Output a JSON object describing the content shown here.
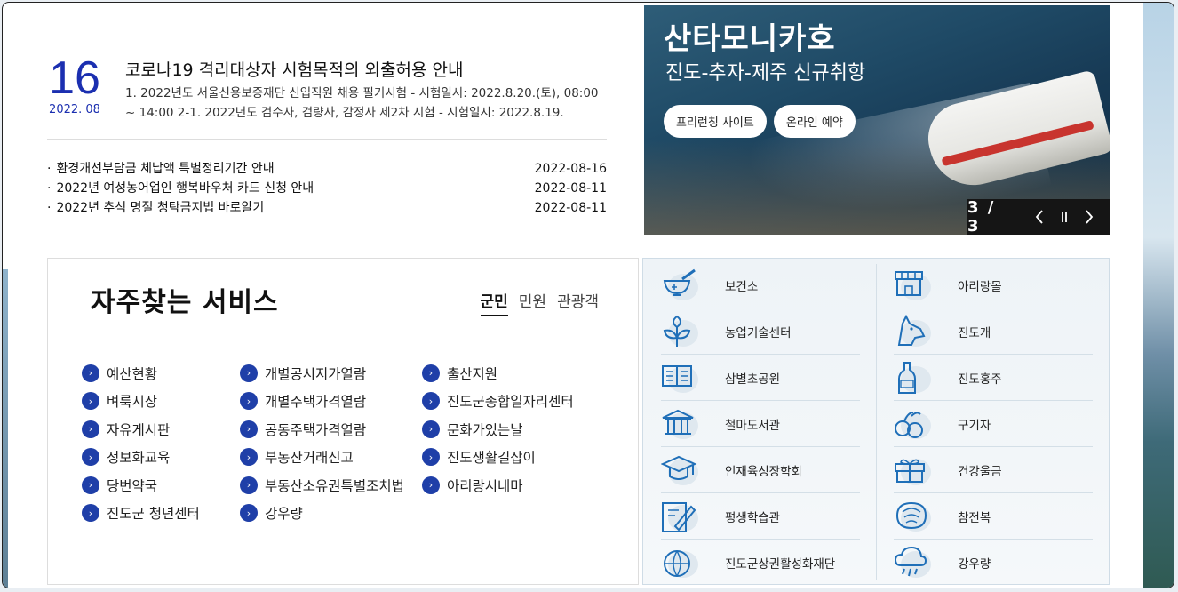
{
  "news": {
    "featured": {
      "day": "16",
      "year_month": "2022. 08",
      "title": "코로나19 격리대상자 시험목적의 외출허용 안내",
      "body": "1. 2022년도 서울신용보증재단 신입직원 채용 필기시험 - 시험일시: 2022.8.20.(토), 08:00 ~ 14:00 2-1. 2022년도 검수사, 검량사, 감정사 제2차 시험 - 시험일시: 2022.8.19."
    },
    "items": [
      {
        "title": "환경개선부담금 체납액 특별정리기간 안내",
        "date": "2022-08-16"
      },
      {
        "title": "2022년 여성농어업인 행복바우처 카드 신청 안내",
        "date": "2022-08-11"
      },
      {
        "title": "2022년 추석 명절 청탁금지법 바로알기",
        "date": "2022-08-11"
      }
    ]
  },
  "banner": {
    "title": "산타모니카호",
    "subtitle": "진도-추자-제주 신규취항",
    "buttons": [
      "프리런칭 사이트",
      "온라인 예약"
    ],
    "pager": "3 / 3",
    "icons": [
      "chevron-left-icon",
      "pause-icon",
      "chevron-right-icon"
    ]
  },
  "services": {
    "title": "자주찾는 서비스",
    "tabs": [
      "군민",
      "민원",
      "관광객"
    ],
    "active_tab": "군민",
    "items": [
      "예산현황",
      "개별공시지가열람",
      "출산지원",
      "벼룩시장",
      "개별주택가격열람",
      "진도군종합일자리센터",
      "자유게시판",
      "공동주택가격열람",
      "문화가있는날",
      "정보화교육",
      "부동산거래신고",
      "진도생활길잡이",
      "당번약국",
      "부동산소유권특별조치법",
      "아리랑시네마",
      "진도군 청년센터",
      "강우량"
    ]
  },
  "orgs": {
    "left": [
      {
        "label": "보건소",
        "icon": "mortar-pestle-icon"
      },
      {
        "label": "농업기술센터",
        "icon": "sprout-icon"
      },
      {
        "label": "삼별초공원",
        "icon": "book-icon"
      },
      {
        "label": "철마도서관",
        "icon": "library-building-icon"
      },
      {
        "label": "인재육성장학회",
        "icon": "graduation-cap-icon"
      },
      {
        "label": "평생학습관",
        "icon": "pencil-note-icon"
      },
      {
        "label": "진도군상권활성화재단",
        "icon": "globe-store-icon"
      }
    ],
    "right": [
      {
        "label": "아리랑몰",
        "icon": "shop-icon"
      },
      {
        "label": "진도개",
        "icon": "dog-icon"
      },
      {
        "label": "진도홍주",
        "icon": "bottle-icon"
      },
      {
        "label": "구기자",
        "icon": "berry-icon"
      },
      {
        "label": "건강울금",
        "icon": "gift-box-icon"
      },
      {
        "label": "참전복",
        "icon": "abalone-shell-icon"
      },
      {
        "label": "강우량",
        "icon": "rain-cloud-icon"
      }
    ]
  },
  "colors": {
    "accent": "#1f3fa8",
    "icon": "#1f6fb8",
    "date": "#1b2fb0"
  }
}
